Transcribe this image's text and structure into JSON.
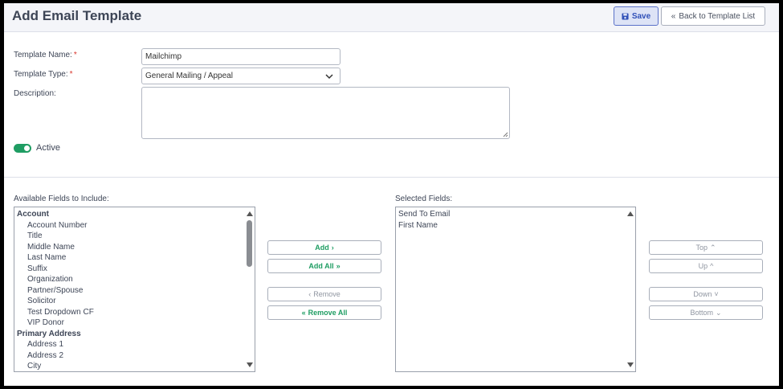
{
  "header": {
    "title": "Add Email Template",
    "save_icon": "floppy-disk-icon",
    "save_label": "Save",
    "back_icon": "double-chevron-left-icon",
    "back_label": "Back to Template List"
  },
  "form": {
    "template_name_label": "Template Name:",
    "template_name_value": "Mailchimp",
    "template_type_label": "Template Type:",
    "template_type_value": "General Mailing / Appeal",
    "description_label": "Description:",
    "description_value": "",
    "required_marker": "*",
    "active_label": "Active",
    "active_on": true
  },
  "available": {
    "label": "Available Fields to Include:",
    "items": [
      {
        "text": "Account",
        "group": true
      },
      {
        "text": "Account Number",
        "group": false
      },
      {
        "text": "Title",
        "group": false
      },
      {
        "text": "Middle Name",
        "group": false
      },
      {
        "text": "Last Name",
        "group": false
      },
      {
        "text": "Suffix",
        "group": false
      },
      {
        "text": "Organization",
        "group": false
      },
      {
        "text": "Partner/Spouse",
        "group": false
      },
      {
        "text": "Solicitor",
        "group": false
      },
      {
        "text": "Test Dropdown CF",
        "group": false
      },
      {
        "text": "VIP Donor",
        "group": false
      },
      {
        "text": "Primary Address",
        "group": true
      },
      {
        "text": "Address 1",
        "group": false
      },
      {
        "text": "Address 2",
        "group": false
      },
      {
        "text": "City",
        "group": false
      }
    ]
  },
  "selected": {
    "label": "Selected Fields:",
    "items": [
      "Send To Email",
      "First Name"
    ]
  },
  "transfer_buttons": {
    "add": "Add",
    "add_all": "Add All",
    "remove": "Remove",
    "remove_all": "Remove All"
  },
  "order_buttons": {
    "top": "Top",
    "up": "Up",
    "down": "Down",
    "bottom": "Bottom"
  },
  "colors": {
    "accent_green": "#1f9d63",
    "primary_blue": "#3050b8",
    "required_red": "#d9342b",
    "disabled_gray": "#8f95a0"
  }
}
